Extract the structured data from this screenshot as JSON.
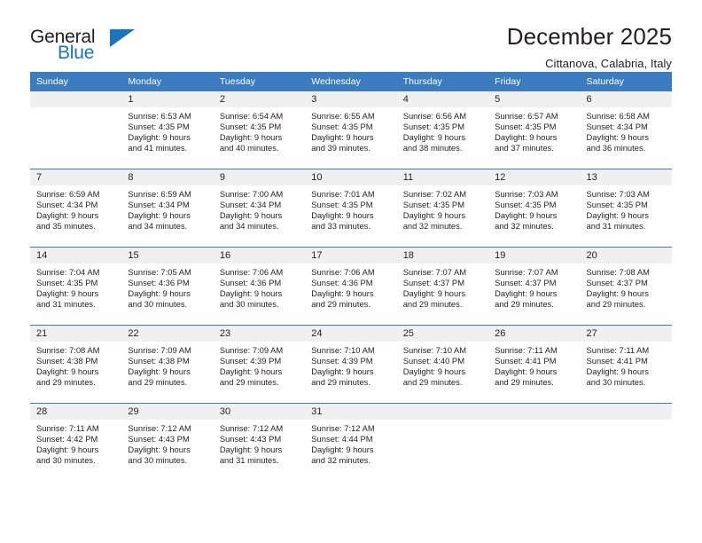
{
  "brand": {
    "word_one": "General",
    "word_two": "Blue",
    "logo_icon": "triangle-logo-icon",
    "accent_color": "#1b75bb"
  },
  "header": {
    "title": "December 2025",
    "subtitle": "Cittanova, Calabria, Italy"
  },
  "theme": {
    "header_row_color": "#3b7cc0",
    "day_band_color": "#f0f0f0",
    "text_color": "#231f20"
  },
  "calendar": {
    "weekday_headers": [
      "Sunday",
      "Monday",
      "Tuesday",
      "Wednesday",
      "Thursday",
      "Friday",
      "Saturday"
    ],
    "weeks": [
      [
        {
          "day": "",
          "sunrise": "",
          "sunset": "",
          "daylight_line1": "",
          "daylight_line2": "",
          "empty": true
        },
        {
          "day": "1",
          "sunrise": "Sunrise: 6:53 AM",
          "sunset": "Sunset: 4:35 PM",
          "daylight_line1": "Daylight: 9 hours",
          "daylight_line2": "and 41 minutes.",
          "empty": false
        },
        {
          "day": "2",
          "sunrise": "Sunrise: 6:54 AM",
          "sunset": "Sunset: 4:35 PM",
          "daylight_line1": "Daylight: 9 hours",
          "daylight_line2": "and 40 minutes.",
          "empty": false
        },
        {
          "day": "3",
          "sunrise": "Sunrise: 6:55 AM",
          "sunset": "Sunset: 4:35 PM",
          "daylight_line1": "Daylight: 9 hours",
          "daylight_line2": "and 39 minutes.",
          "empty": false
        },
        {
          "day": "4",
          "sunrise": "Sunrise: 6:56 AM",
          "sunset": "Sunset: 4:35 PM",
          "daylight_line1": "Daylight: 9 hours",
          "daylight_line2": "and 38 minutes.",
          "empty": false
        },
        {
          "day": "5",
          "sunrise": "Sunrise: 6:57 AM",
          "sunset": "Sunset: 4:35 PM",
          "daylight_line1": "Daylight: 9 hours",
          "daylight_line2": "and 37 minutes.",
          "empty": false
        },
        {
          "day": "6",
          "sunrise": "Sunrise: 6:58 AM",
          "sunset": "Sunset: 4:34 PM",
          "daylight_line1": "Daylight: 9 hours",
          "daylight_line2": "and 36 minutes.",
          "empty": false
        }
      ],
      [
        {
          "day": "7",
          "sunrise": "Sunrise: 6:59 AM",
          "sunset": "Sunset: 4:34 PM",
          "daylight_line1": "Daylight: 9 hours",
          "daylight_line2": "and 35 minutes.",
          "empty": false
        },
        {
          "day": "8",
          "sunrise": "Sunrise: 6:59 AM",
          "sunset": "Sunset: 4:34 PM",
          "daylight_line1": "Daylight: 9 hours",
          "daylight_line2": "and 34 minutes.",
          "empty": false
        },
        {
          "day": "9",
          "sunrise": "Sunrise: 7:00 AM",
          "sunset": "Sunset: 4:34 PM",
          "daylight_line1": "Daylight: 9 hours",
          "daylight_line2": "and 34 minutes.",
          "empty": false
        },
        {
          "day": "10",
          "sunrise": "Sunrise: 7:01 AM",
          "sunset": "Sunset: 4:35 PM",
          "daylight_line1": "Daylight: 9 hours",
          "daylight_line2": "and 33 minutes.",
          "empty": false
        },
        {
          "day": "11",
          "sunrise": "Sunrise: 7:02 AM",
          "sunset": "Sunset: 4:35 PM",
          "daylight_line1": "Daylight: 9 hours",
          "daylight_line2": "and 32 minutes.",
          "empty": false
        },
        {
          "day": "12",
          "sunrise": "Sunrise: 7:03 AM",
          "sunset": "Sunset: 4:35 PM",
          "daylight_line1": "Daylight: 9 hours",
          "daylight_line2": "and 32 minutes.",
          "empty": false
        },
        {
          "day": "13",
          "sunrise": "Sunrise: 7:03 AM",
          "sunset": "Sunset: 4:35 PM",
          "daylight_line1": "Daylight: 9 hours",
          "daylight_line2": "and 31 minutes.",
          "empty": false
        }
      ],
      [
        {
          "day": "14",
          "sunrise": "Sunrise: 7:04 AM",
          "sunset": "Sunset: 4:35 PM",
          "daylight_line1": "Daylight: 9 hours",
          "daylight_line2": "and 31 minutes.",
          "empty": false
        },
        {
          "day": "15",
          "sunrise": "Sunrise: 7:05 AM",
          "sunset": "Sunset: 4:36 PM",
          "daylight_line1": "Daylight: 9 hours",
          "daylight_line2": "and 30 minutes.",
          "empty": false
        },
        {
          "day": "16",
          "sunrise": "Sunrise: 7:06 AM",
          "sunset": "Sunset: 4:36 PM",
          "daylight_line1": "Daylight: 9 hours",
          "daylight_line2": "and 30 minutes.",
          "empty": false
        },
        {
          "day": "17",
          "sunrise": "Sunrise: 7:06 AM",
          "sunset": "Sunset: 4:36 PM",
          "daylight_line1": "Daylight: 9 hours",
          "daylight_line2": "and 29 minutes.",
          "empty": false
        },
        {
          "day": "18",
          "sunrise": "Sunrise: 7:07 AM",
          "sunset": "Sunset: 4:37 PM",
          "daylight_line1": "Daylight: 9 hours",
          "daylight_line2": "and 29 minutes.",
          "empty": false
        },
        {
          "day": "19",
          "sunrise": "Sunrise: 7:07 AM",
          "sunset": "Sunset: 4:37 PM",
          "daylight_line1": "Daylight: 9 hours",
          "daylight_line2": "and 29 minutes.",
          "empty": false
        },
        {
          "day": "20",
          "sunrise": "Sunrise: 7:08 AM",
          "sunset": "Sunset: 4:37 PM",
          "daylight_line1": "Daylight: 9 hours",
          "daylight_line2": "and 29 minutes.",
          "empty": false
        }
      ],
      [
        {
          "day": "21",
          "sunrise": "Sunrise: 7:08 AM",
          "sunset": "Sunset: 4:38 PM",
          "daylight_line1": "Daylight: 9 hours",
          "daylight_line2": "and 29 minutes.",
          "empty": false
        },
        {
          "day": "22",
          "sunrise": "Sunrise: 7:09 AM",
          "sunset": "Sunset: 4:38 PM",
          "daylight_line1": "Daylight: 9 hours",
          "daylight_line2": "and 29 minutes.",
          "empty": false
        },
        {
          "day": "23",
          "sunrise": "Sunrise: 7:09 AM",
          "sunset": "Sunset: 4:39 PM",
          "daylight_line1": "Daylight: 9 hours",
          "daylight_line2": "and 29 minutes.",
          "empty": false
        },
        {
          "day": "24",
          "sunrise": "Sunrise: 7:10 AM",
          "sunset": "Sunset: 4:39 PM",
          "daylight_line1": "Daylight: 9 hours",
          "daylight_line2": "and 29 minutes.",
          "empty": false
        },
        {
          "day": "25",
          "sunrise": "Sunrise: 7:10 AM",
          "sunset": "Sunset: 4:40 PM",
          "daylight_line1": "Daylight: 9 hours",
          "daylight_line2": "and 29 minutes.",
          "empty": false
        },
        {
          "day": "26",
          "sunrise": "Sunrise: 7:11 AM",
          "sunset": "Sunset: 4:41 PM",
          "daylight_line1": "Daylight: 9 hours",
          "daylight_line2": "and 29 minutes.",
          "empty": false
        },
        {
          "day": "27",
          "sunrise": "Sunrise: 7:11 AM",
          "sunset": "Sunset: 4:41 PM",
          "daylight_line1": "Daylight: 9 hours",
          "daylight_line2": "and 30 minutes.",
          "empty": false
        }
      ],
      [
        {
          "day": "28",
          "sunrise": "Sunrise: 7:11 AM",
          "sunset": "Sunset: 4:42 PM",
          "daylight_line1": "Daylight: 9 hours",
          "daylight_line2": "and 30 minutes.",
          "empty": false
        },
        {
          "day": "29",
          "sunrise": "Sunrise: 7:12 AM",
          "sunset": "Sunset: 4:43 PM",
          "daylight_line1": "Daylight: 9 hours",
          "daylight_line2": "and 30 minutes.",
          "empty": false
        },
        {
          "day": "30",
          "sunrise": "Sunrise: 7:12 AM",
          "sunset": "Sunset: 4:43 PM",
          "daylight_line1": "Daylight: 9 hours",
          "daylight_line2": "and 31 minutes.",
          "empty": false
        },
        {
          "day": "31",
          "sunrise": "Sunrise: 7:12 AM",
          "sunset": "Sunset: 4:44 PM",
          "daylight_line1": "Daylight: 9 hours",
          "daylight_line2": "and 32 minutes.",
          "empty": false
        },
        {
          "day": "",
          "sunrise": "",
          "sunset": "",
          "daylight_line1": "",
          "daylight_line2": "",
          "empty": true
        },
        {
          "day": "",
          "sunrise": "",
          "sunset": "",
          "daylight_line1": "",
          "daylight_line2": "",
          "empty": true
        },
        {
          "day": "",
          "sunrise": "",
          "sunset": "",
          "daylight_line1": "",
          "daylight_line2": "",
          "empty": true
        }
      ]
    ]
  }
}
